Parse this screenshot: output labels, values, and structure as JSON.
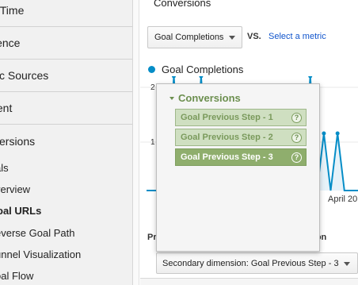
{
  "sidebar": {
    "items": [
      {
        "label": "l-Time"
      },
      {
        "label": "ience"
      },
      {
        "label": "fic Sources"
      },
      {
        "label": "tent"
      },
      {
        "label": "versions"
      }
    ],
    "sub_items": [
      {
        "label": "als"
      },
      {
        "label": "verview"
      },
      {
        "label": "oal URLs"
      },
      {
        "label": "everse Goal Path"
      },
      {
        "label": "unnel Visualization"
      },
      {
        "label": "oal Flow"
      }
    ]
  },
  "main": {
    "title": "Conversions",
    "metric_select": "Goal Completions",
    "vs_label": "VS.",
    "select_metric_link": "Select a metric",
    "legend_label": "Goal Completions",
    "legend_color": "#058dc7",
    "axis_label_top": "2",
    "axis_label_mid": "1",
    "date_label": "April 20",
    "table_header_left": "Pr",
    "table_header_right": "ation",
    "secondary_dimension": "Secondary dimension: Goal Previous Step - 3"
  },
  "popup": {
    "group_label": "Conversions",
    "items": [
      {
        "label": "Goal Previous Step - 1",
        "help": "?"
      },
      {
        "label": "Goal Previous Step - 2",
        "help": "?"
      },
      {
        "label": "Goal Previous Step - 3",
        "help": "?"
      }
    ],
    "selected_index": 2
  },
  "chart_data": {
    "type": "area",
    "series": [
      {
        "values": [
          0,
          0,
          0,
          0,
          2,
          0,
          0,
          0,
          2,
          0,
          0,
          0,
          0,
          0,
          0,
          0,
          0,
          0,
          0,
          0,
          0,
          0,
          0,
          0,
          2,
          0,
          1,
          0,
          1,
          0,
          0,
          0
        ]
      }
    ],
    "ylim": [
      0,
      2
    ],
    "color": "#058dc7"
  }
}
